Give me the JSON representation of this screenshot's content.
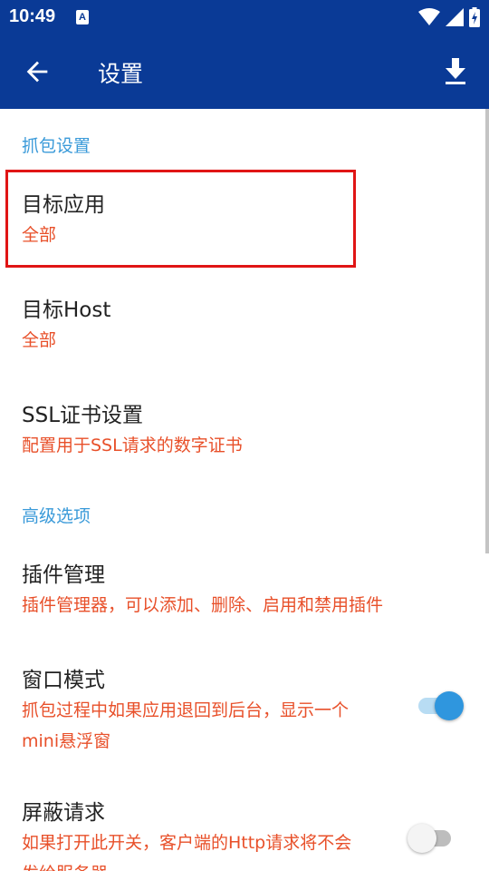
{
  "status_bar": {
    "time": "10:49",
    "notification_badge": "A"
  },
  "app_bar": {
    "title": "设置"
  },
  "sections": {
    "capture": {
      "header": "抓包设置",
      "target_app": {
        "title": "目标应用",
        "summary": "全部"
      },
      "target_host": {
        "title": "目标Host",
        "summary": "全部"
      },
      "ssl": {
        "title": "SSL证书设置",
        "summary": "配置用于SSL请求的数字证书"
      }
    },
    "advanced": {
      "header": "高级选项",
      "plugins": {
        "title": "插件管理",
        "summary": "插件管理器，可以添加、删除、启用和禁用插件"
      },
      "window_mode": {
        "title": "窗口模式",
        "summary_line1": "抓包过程中如果应用退回到后台，显示一个",
        "summary_line2": "mini悬浮窗",
        "enabled": true
      },
      "block_requests": {
        "title": "屏蔽请求",
        "summary_line1": "如果打开此开关，客户端的Http请求将不会",
        "summary_line2": "发给服务器",
        "enabled": false
      }
    }
  },
  "colors": {
    "app_bar": "#0a3a96",
    "category": "#3a9ad9",
    "summary": "#e8502a",
    "toggle_on": "#2f96de",
    "highlight": "#e01515"
  }
}
